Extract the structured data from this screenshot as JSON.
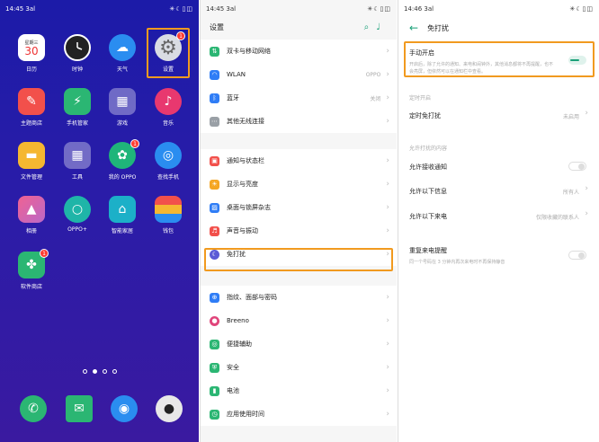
{
  "home": {
    "status": {
      "time": "14:45",
      "signal": "3al",
      "icons": "✳☾▯◫"
    },
    "calendar": {
      "weekday": "星期三",
      "day": "30"
    },
    "apps": [
      {
        "label": "日历",
        "icon": "calendar-icon"
      },
      {
        "label": "时钟",
        "icon": "clock-icon"
      },
      {
        "label": "天气",
        "icon": "weather-icon"
      },
      {
        "label": "设置",
        "icon": "gear-icon",
        "badge": "1"
      },
      {
        "label": "主题商店",
        "icon": "theme-store-icon"
      },
      {
        "label": "手机管家",
        "icon": "phone-manager-icon"
      },
      {
        "label": "游戏",
        "icon": "game-folder-icon"
      },
      {
        "label": "音乐",
        "icon": "music-icon"
      },
      {
        "label": "文件管理",
        "icon": "folder-icon"
      },
      {
        "label": "工具",
        "icon": "tools-folder-icon"
      },
      {
        "label": "我的 OPPO",
        "icon": "my-oppo-icon",
        "badge": "1"
      },
      {
        "label": "查找手机",
        "icon": "find-phone-icon"
      },
      {
        "label": "相册",
        "icon": "gallery-icon"
      },
      {
        "label": "OPPO+",
        "icon": "oppo-plus-icon"
      },
      {
        "label": "智能家居",
        "icon": "smart-home-icon"
      },
      {
        "label": "钱包",
        "icon": "wallet-icon"
      },
      {
        "label": "软件商店",
        "icon": "app-store-icon",
        "badge": "1"
      }
    ],
    "dock": [
      "phone-icon",
      "messages-icon",
      "browser-icon",
      "camera-icon"
    ]
  },
  "settings": {
    "status": {
      "time": "14:45",
      "signal": "3al",
      "icons": "✳☾▯◫"
    },
    "title": "设置",
    "groups": [
      [
        {
          "label": "双卡与移动网络",
          "value": "",
          "icon": "sim-icon",
          "color": "#2bb673"
        },
        {
          "label": "WLAN",
          "value": "OPPO",
          "icon": "wifi-icon",
          "color": "#2f7df6"
        },
        {
          "label": "蓝牙",
          "value": "关闭",
          "icon": "bluetooth-icon",
          "color": "#2f7df6"
        },
        {
          "label": "其他无线连接",
          "value": "",
          "icon": "wireless-icon",
          "color": "#9aa0a6"
        }
      ],
      [
        {
          "label": "通知与状态栏",
          "value": "",
          "icon": "notification-icon",
          "color": "#f2504b"
        },
        {
          "label": "显示与亮度",
          "value": "",
          "icon": "brightness-icon",
          "color": "#f5a623"
        },
        {
          "label": "桌面与锁屏杂志",
          "value": "",
          "icon": "wallpaper-icon",
          "color": "#2f7df6"
        },
        {
          "label": "声音与振动",
          "value": "",
          "icon": "sound-icon",
          "color": "#f2504b"
        },
        {
          "label": "免打扰",
          "value": "",
          "icon": "moon-icon",
          "color": "#5b5bd6"
        }
      ],
      [
        {
          "label": "指纹、面部与密码",
          "value": "",
          "icon": "fingerprint-icon",
          "color": "#2f7df6"
        },
        {
          "label": "Breeno",
          "value": "",
          "icon": "breeno-icon",
          "color": "#e0457b"
        },
        {
          "label": "便捷辅助",
          "value": "",
          "icon": "assist-icon",
          "color": "#2bb673"
        },
        {
          "label": "安全",
          "value": "",
          "icon": "shield-icon",
          "color": "#2bb673"
        },
        {
          "label": "电池",
          "value": "",
          "icon": "battery-icon",
          "color": "#2bb673"
        },
        {
          "label": "应用使用时间",
          "value": "",
          "icon": "usage-time-icon",
          "color": "#2bb673"
        }
      ]
    ]
  },
  "dnd": {
    "status": {
      "time": "14:46",
      "signal": "3al",
      "icons": "✳☾▯◫"
    },
    "title": "免打扰",
    "manual": {
      "title": "手动开启",
      "desc": "开启后，除了允许的通知、来电和闹钟外，其他消息都将不再提醒，也不会亮屏，但依然可以在通知栏中查看。",
      "on": true
    },
    "section_schedule": "定时开启",
    "schedule": {
      "title": "定时免打扰",
      "value": "未启用"
    },
    "section_allow": "允许打扰的内容",
    "allow_notifications": {
      "title": "允许接收通知",
      "on": false
    },
    "allow_messages": {
      "title": "允许以下信息",
      "value": "所有人"
    },
    "allow_calls": {
      "title": "允许以下来电",
      "value": "仅限收藏的联系人"
    },
    "repeat_calls": {
      "title": "重复来电提醒",
      "desc": "同一个号码在 3 分钟内再次来电时不再保持静音",
      "on": false
    }
  }
}
